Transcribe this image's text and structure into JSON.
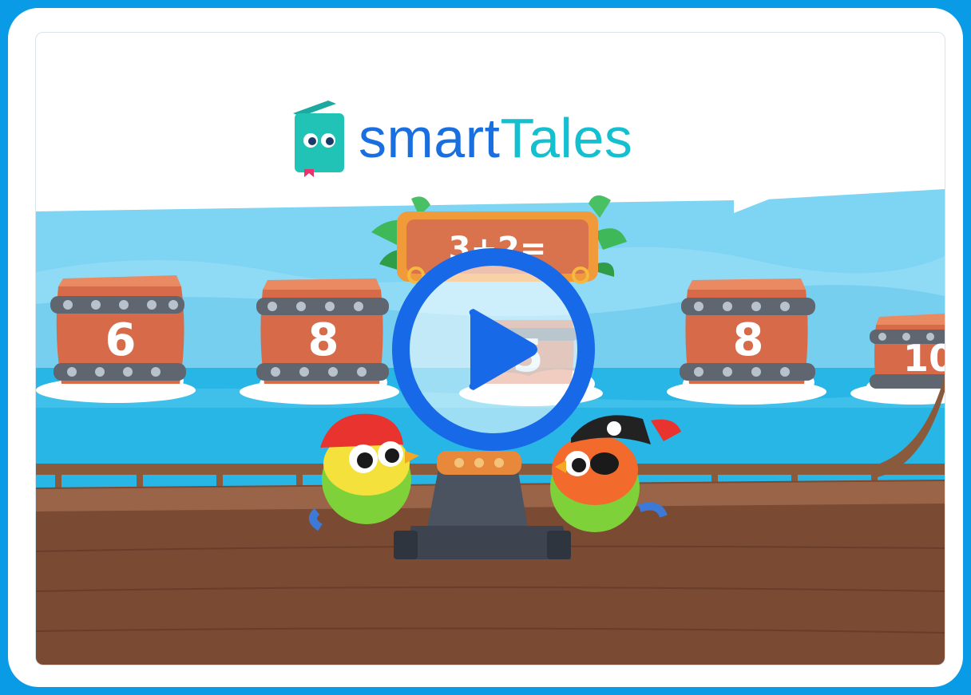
{
  "brand": {
    "name_part1": "smart",
    "name_part2": "Tales"
  },
  "game": {
    "equation": "3+2=",
    "barrels": [
      "6",
      "8",
      "5",
      "8",
      "10"
    ]
  },
  "video": {
    "play_icon": "play-icon"
  },
  "colors": {
    "background": "#0a9be6",
    "brand_blue": "#1a6fe0",
    "brand_teal": "#14bfd0",
    "play_ring": "#1769e8"
  }
}
